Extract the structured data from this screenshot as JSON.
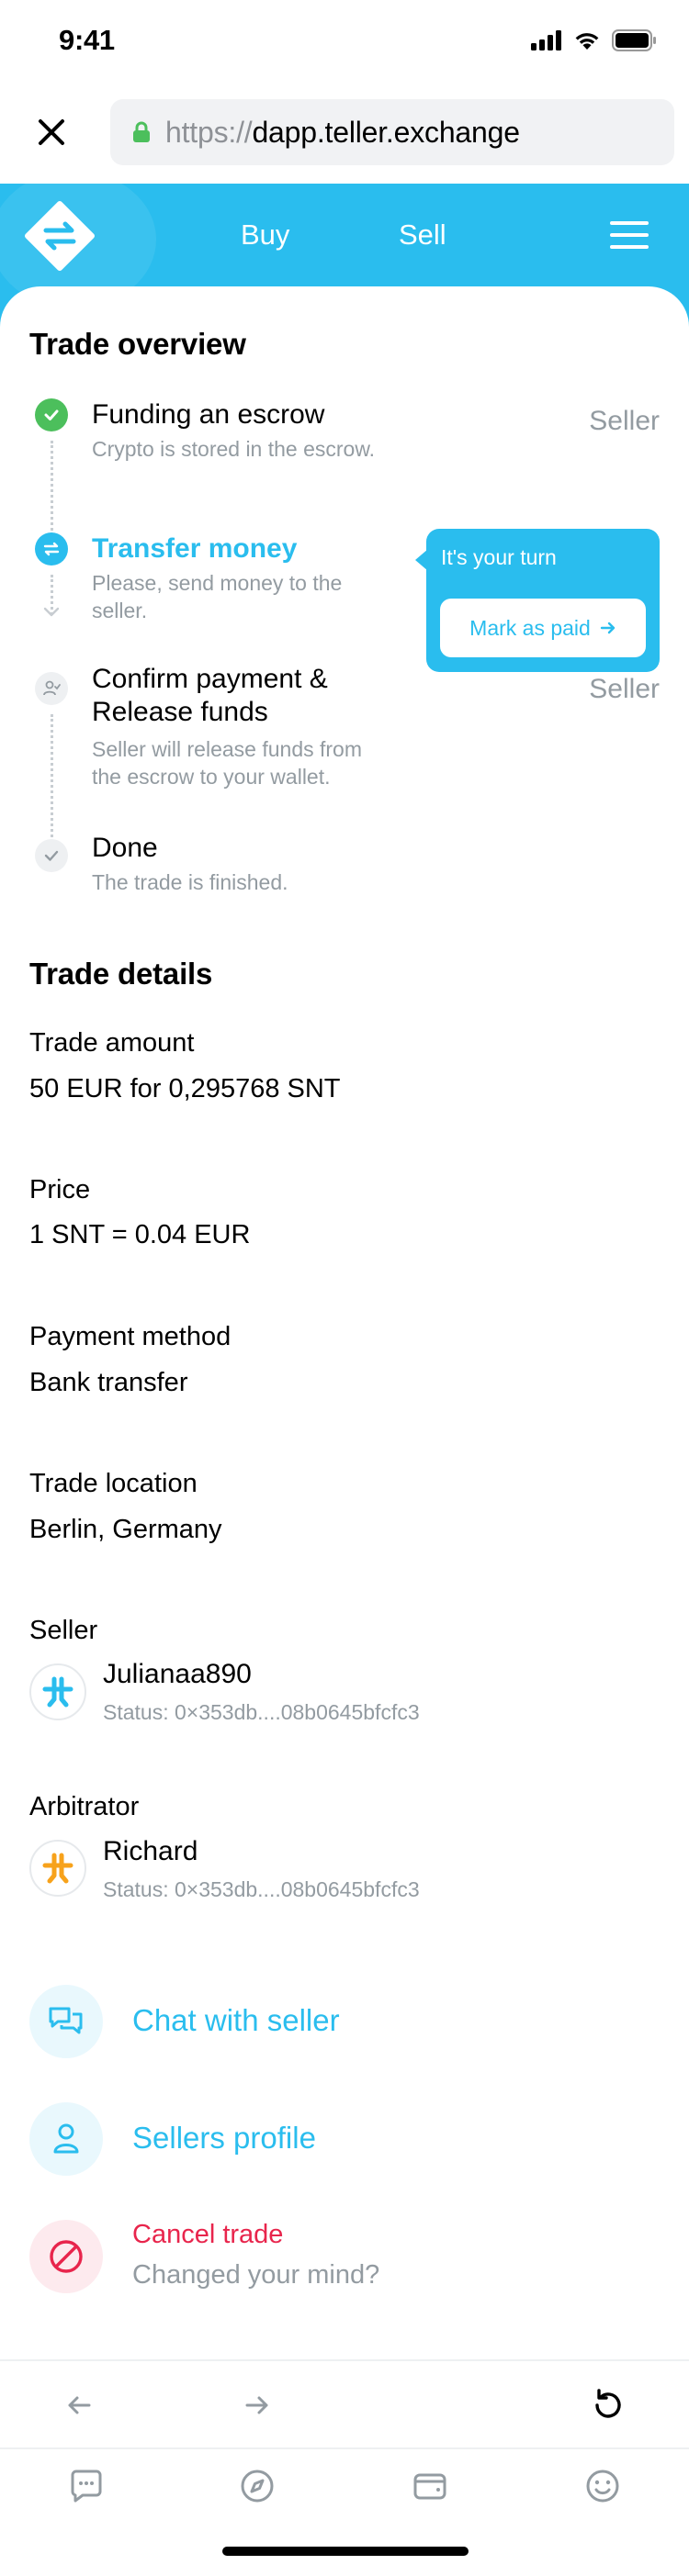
{
  "status_bar": {
    "time": "9:41"
  },
  "browser": {
    "url_protocol": "https://",
    "url_host": "dapp.teller.exchange"
  },
  "header": {
    "nav": {
      "buy": "Buy",
      "sell": "Sell"
    },
    "brand_color": "#2abdee"
  },
  "trade_overview": {
    "title": "Trade overview",
    "steps": [
      {
        "title": "Funding an escrow",
        "desc": "Crypto is stored in the escrow.",
        "role": "Seller",
        "state": "completed"
      },
      {
        "title": "Transfer money",
        "desc_lines": [
          "Please, send money to the",
          "seller."
        ],
        "state": "active"
      },
      {
        "title_lines": [
          "Confirm payment &",
          "Release funds"
        ],
        "desc_lines": [
          "Seller will release funds from",
          "the escrow to your wallet."
        ],
        "role": "Seller",
        "state": "pending"
      },
      {
        "title": "Done",
        "desc": "The trade is finished.",
        "state": "pending"
      }
    ],
    "tooltip": {
      "text": "It's your turn",
      "button": "Mark as paid"
    }
  },
  "trade_details": {
    "title": "Trade details",
    "amount": {
      "label": "Trade amount",
      "value": "50 EUR for 0,295768 SNT"
    },
    "price": {
      "label": "Price",
      "value": "1 SNT = 0.04 EUR"
    },
    "payment": {
      "label": "Payment method",
      "value": "Bank transfer"
    },
    "location": {
      "label": "Trade location",
      "value": "Berlin, Germany"
    },
    "seller": {
      "label": "Seller",
      "name": "Julianaa890",
      "status": "Status: 0×353db....08b0645bfcfc3",
      "avatar_color": "#2abdee"
    },
    "arbitrator": {
      "label": "Arbitrator",
      "name": "Richard",
      "status": "Status: 0×353db....08b0645bfcfc3",
      "avatar_color": "#f7a21b"
    }
  },
  "actions": {
    "chat": "Chat with seller",
    "profile": "Sellers profile",
    "cancel": "Cancel trade",
    "cancel_sub": "Changed your mind?",
    "cancel_color": "#e8254c"
  },
  "icons": {
    "close": "close-icon",
    "lock": "lock-icon",
    "menu": "hamburger-menu-icon",
    "back": "arrow-left-icon",
    "forward": "arrow-right-icon",
    "reload": "reload-icon",
    "chat_tab": "chat-bubble-icon",
    "browse_tab": "compass-icon",
    "wallet_tab": "wallet-icon",
    "profile_tab": "smiley-icon"
  }
}
